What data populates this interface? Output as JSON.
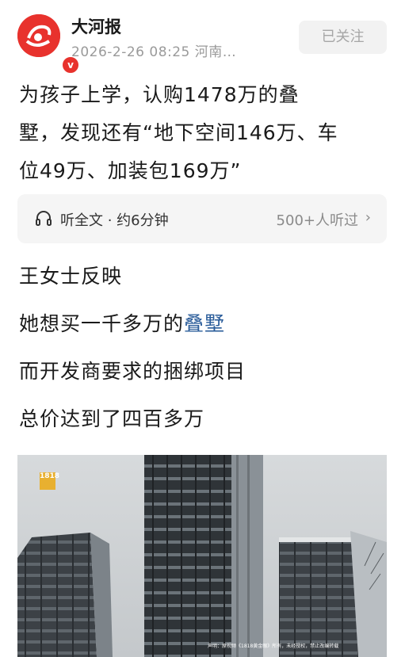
{
  "header": {
    "source_name": "大河报",
    "verified_badge": "v",
    "meta": "2026-2-26 08:25 河南…",
    "follow_label": "已关注"
  },
  "article": {
    "title_lines": [
      "为孩子上学，认购1478万的叠",
      "墅，发现还有“地下空间146万、车",
      "位49万、加装包169万”"
    ],
    "audio": {
      "label": "听全文 · 约6分钟",
      "listeners": "500+人听过",
      "chevron": "›"
    },
    "paragraphs": [
      {
        "text": "王女士反映"
      },
      {
        "prefix": "她想买一千多万的",
        "link": "叠墅"
      },
      {
        "text": "而开发商要求的捆绑项目"
      },
      {
        "text": "总价达到了四百多万"
      }
    ],
    "image": {
      "logo_text": "1818",
      "caption": "声明：原视频《1818黄金眼》所有，未经授权，禁止改编转载"
    }
  },
  "colors": {
    "brand_red": "#e8322d",
    "link_blue": "#2a5c9a",
    "meta_gray": "#9a9a9a"
  }
}
